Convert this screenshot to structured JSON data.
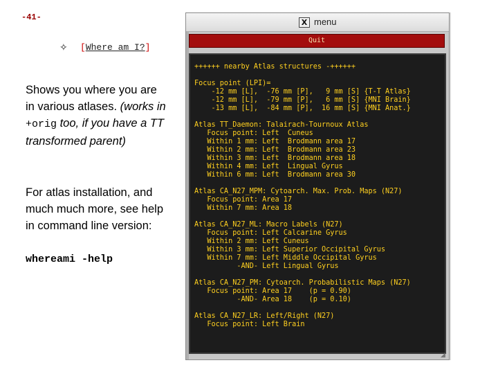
{
  "slide": {
    "page_number": "-41-",
    "bullet_glyph": "✧",
    "button": {
      "bracket_open": "[",
      "label": "Where am I?",
      "bracket_close": "]"
    },
    "description": {
      "line1": "Shows you where you are in various atlases.",
      "paren_open": "(works in ",
      "mono_word": "+orig",
      "paren_rest": " too, if you have a TT transformed parent)"
    },
    "description2": "For atlas installation, and much much more, see help in command line version:",
    "command": "whereami -help"
  },
  "window": {
    "title": "menu",
    "x_logo": "X",
    "quit_label": "Quit",
    "terminal_text": "++++++ nearby Atlas structures -++++++\n\nFocus point (LPI)=\n    -12 mm [L],  -76 mm [P],   9 mm [S] {T-T Atlas}\n    -12 mm [L],  -79 mm [P],   6 mm [S] {MNI Brain}\n    -13 mm [L],  -84 mm [P],  16 mm [S] {MNI Anat.}\n\nAtlas TT_Daemon: Talairach-Tournoux Atlas\n   Focus point: Left  Cuneus\n   Within 1 mm: Left  Brodmann area 17\n   Within 2 mm: Left  Brodmann area 23\n   Within 3 mm: Left  Brodmann area 18\n   Within 4 mm: Left  Lingual Gyrus\n   Within 6 mm: Left  Brodmann area 30\n\nAtlas CA_N27_MPM: Cytoarch. Max. Prob. Maps (N27)\n   Focus point: Area 17\n   Within 7 mm: Area 18\n\nAtlas CA_N27_ML: Macro Labels (N27)\n   Focus point: Left Calcarine Gyrus\n   Within 2 mm: Left Cuneus\n   Within 3 mm: Left Superior Occipital Gyrus\n   Within 7 mm: Left Middle Occipital Gyrus\n          -AND- Left Lingual Gyrus\n\nAtlas CA_N27_PM: Cytoarch. Probabilistic Maps (N27)\n   Focus point: Area 17    (p = 0.90)\n          -AND- Area 18    (p = 0.10)\n\nAtlas CA_N27_LR: Left/Right (N27)\n   Focus point: Left Brain"
  },
  "colors": {
    "page_number": "#990000",
    "quit_bg": "#a30d0d",
    "terminal_bg": "#1c1c1c",
    "terminal_text": "#ffd020"
  }
}
